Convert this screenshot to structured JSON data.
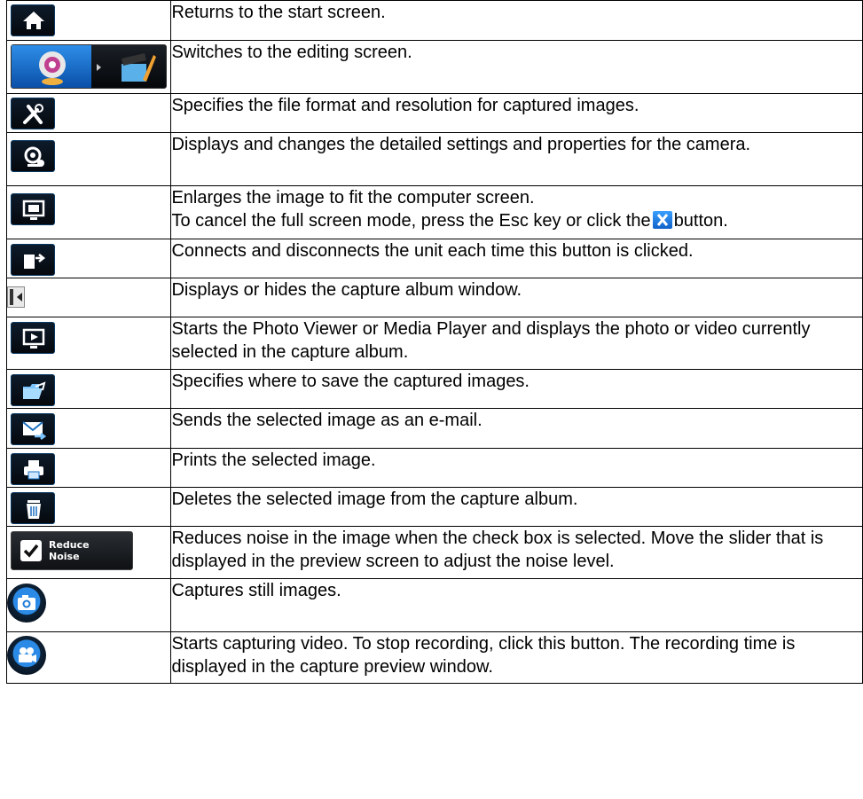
{
  "rows": [
    {
      "icon": "home-icon",
      "text": "Returns to the start screen."
    },
    {
      "icon": "camera-to-editing-switch-icon",
      "text": "Switches to the editing screen."
    },
    {
      "icon": "tools-icon",
      "text": "Specifies the file format and resolution for captured images."
    },
    {
      "icon": "camera-settings-icon",
      "text": "Displays and changes the detailed settings and properties for the camera."
    },
    {
      "icon": "full-screen-icon",
      "text": "Enlarges the image to fit the computer screen.",
      "text2a": "To cancel the full screen mode, press the Esc key or click the",
      "text2b": "button."
    },
    {
      "icon": "connect-icon",
      "text": "Connects and disconnects the unit each time this button is clicked."
    },
    {
      "icon": "album-toggle-icon",
      "text": "Displays or hides the capture album window."
    },
    {
      "icon": "play-viewer-icon",
      "text": "Starts the Photo Viewer or Media Player and displays the photo or video currently selected in the capture album."
    },
    {
      "icon": "folder-icon",
      "text": "Specifies where to save the captured images."
    },
    {
      "icon": "email-icon",
      "text": "Sends the selected image as an e-mail."
    },
    {
      "icon": "print-icon",
      "text": "Prints the selected image."
    },
    {
      "icon": "trash-icon",
      "text": "Deletes the selected image from the capture album."
    },
    {
      "icon": "reduce-noise-checkbox",
      "label": "Reduce Noise",
      "text": "Reduces noise in the image when the check box is selected. Move the slider that is displayed in the preview screen to adjust the noise level."
    },
    {
      "icon": "camera-capture-icon",
      "text": "Captures still images."
    },
    {
      "icon": "video-record-icon",
      "text": "Starts capturing video. To stop recording, click this button. The recording time is displayed in the capture preview window."
    }
  ]
}
